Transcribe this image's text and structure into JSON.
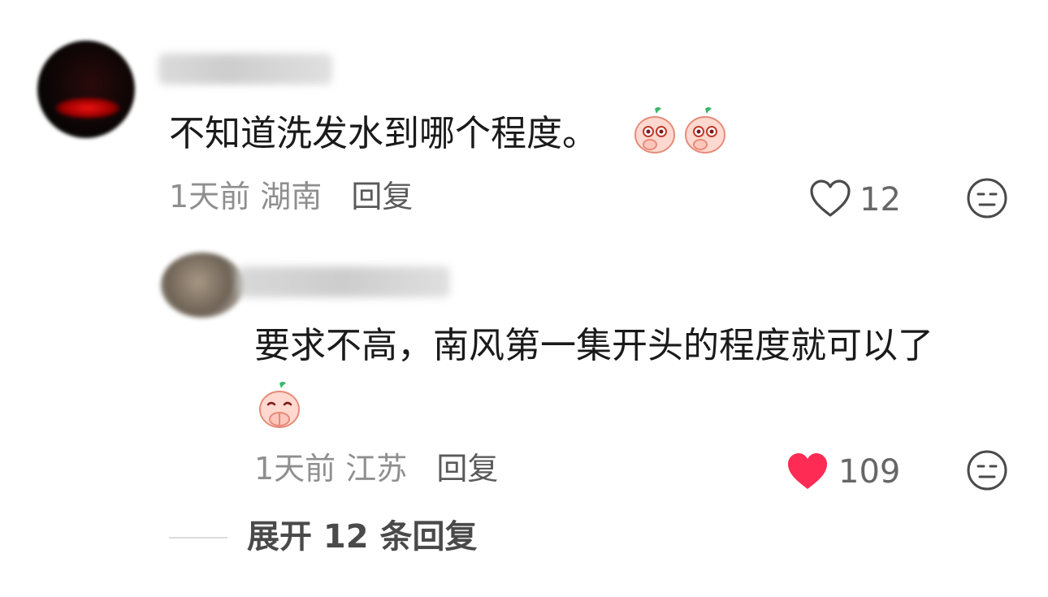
{
  "comments": [
    {
      "text": "不知道洗发水到哪个程度。",
      "emoji_icons": [
        "peach-shy-emoji-icon",
        "peach-shy-emoji-icon"
      ],
      "time": "1天前",
      "location": "湖南",
      "reply_label": "回复",
      "likes": "12",
      "liked": false
    },
    {
      "text": "要求不高，南风第一集开头的程度就可以了",
      "emoji_icons": [
        "peach-pray-emoji-icon"
      ],
      "time": "1天前",
      "location": "江苏",
      "reply_label": "回复",
      "likes": "109",
      "liked": true
    }
  ],
  "expand_replies_label": "展开 12 条回复",
  "colors": {
    "like_active": "#fe2c55",
    "icon_gray": "#4a4a4a",
    "meta_gray": "#8f8f8f"
  }
}
